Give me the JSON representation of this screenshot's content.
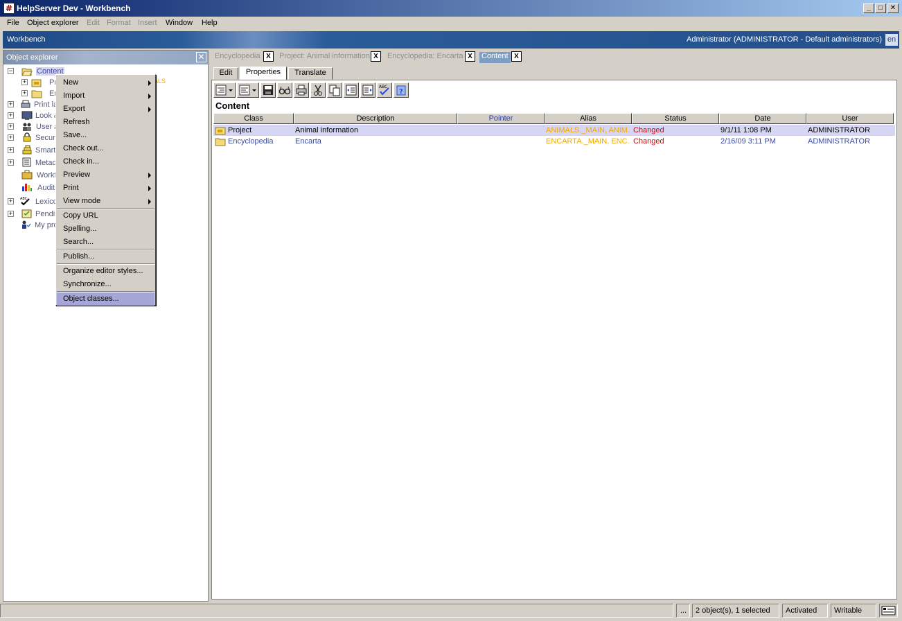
{
  "window": {
    "title": "HelpServer Dev - Workbench",
    "app_icon_glyph": "#",
    "minimize": "_",
    "maximize": "□",
    "close": "✕"
  },
  "menubar": {
    "items": [
      {
        "label": "File",
        "enabled": true
      },
      {
        "label": "Object explorer",
        "enabled": true
      },
      {
        "label": "Edit",
        "enabled": false
      },
      {
        "label": "Format",
        "enabled": false
      },
      {
        "label": "Insert",
        "enabled": false
      },
      {
        "label": "Window",
        "enabled": true
      },
      {
        "label": "Help",
        "enabled": true
      }
    ]
  },
  "workbench": {
    "title": "Workbench",
    "user": "Administrator (ADMINISTRATOR - Default administrators)",
    "language": "en"
  },
  "object_explorer": {
    "title": "Object explorer",
    "close_glyph": "✕",
    "tree": [
      {
        "label": "Content",
        "selected": true
      },
      {
        "label": "Pr"
      },
      {
        "label": "Er"
      },
      {
        "label": "Print la"
      },
      {
        "label": "Look &"
      },
      {
        "label": "User a"
      },
      {
        "label": "Secur"
      },
      {
        "label": "Smart"
      },
      {
        "label": "Metad"
      },
      {
        "label": "Workf"
      },
      {
        "label": "Auditi"
      },
      {
        "label": "Lexico"
      },
      {
        "label": "Pendir"
      },
      {
        "label": "My pro"
      }
    ],
    "tree_suffix": "ALS"
  },
  "context_menu": {
    "items": [
      {
        "label": "New",
        "submenu": true
      },
      {
        "label": "Import",
        "submenu": true
      },
      {
        "label": "Export",
        "submenu": true
      },
      {
        "label": "Refresh"
      },
      {
        "label": "Save..."
      },
      {
        "label": "Check out..."
      },
      {
        "label": "Check in..."
      },
      {
        "label": "Preview",
        "submenu": true
      },
      {
        "label": "Print",
        "submenu": true
      },
      {
        "label": "View mode",
        "submenu": true
      },
      {
        "label": "Copy URL"
      },
      {
        "label": "Spelling..."
      },
      {
        "label": "Search..."
      },
      {
        "label": "Publish..."
      },
      {
        "label": "Organize editor styles..."
      },
      {
        "label": "Synchronize..."
      },
      {
        "label": "Object classes...",
        "selected": true
      }
    ]
  },
  "document_tabs": [
    {
      "label": "Encyclopedia",
      "active": false
    },
    {
      "label": "Project: Animal information",
      "active": false
    },
    {
      "label": "Encyclopedia: Encarta",
      "active": false
    },
    {
      "label": "Content",
      "active": true
    }
  ],
  "tab_close_glyph": "X",
  "subtabs": [
    {
      "label": "Edit",
      "active": false
    },
    {
      "label": "Properties",
      "active": true
    },
    {
      "label": "Translate",
      "active": false
    }
  ],
  "content": {
    "title": "Content",
    "columns": [
      "Class",
      "Description",
      "Pointer",
      "Alias",
      "Status",
      "Date",
      "User"
    ],
    "rows": [
      {
        "class": "Project",
        "description": "Animal information",
        "pointer": "",
        "alias": "ANIMALS._MAIN, ANIM...",
        "status": "Changed",
        "date": "9/1/11 1:08 PM",
        "user": "ADMINISTRATOR",
        "selected": true
      },
      {
        "class": "Encyclopedia",
        "description": "Encarta",
        "pointer": "",
        "alias": "ENCARTA._MAIN, ENC...",
        "status": "Changed",
        "date": "2/16/09 3:11 PM",
        "user": "ADMINISTRATOR",
        "selected": false
      }
    ]
  },
  "toolbar_icons": [
    "indent-menu-icon",
    "outdent-menu-icon",
    "save-icon",
    "preview-glasses-icon",
    "print-icon",
    "cut-icon",
    "copy-icon",
    "move-up-icon",
    "move-down-icon",
    "spelling-icon",
    "help-icon"
  ],
  "statusbar": {
    "ellipsis": "...",
    "selection": "2 object(s), 1 selected",
    "state": "Activated",
    "mode": "Writable"
  },
  "colors": {
    "alias": "#f0a800",
    "status_changed": "#e00000",
    "link_text": "#3a4aa0",
    "selected_row": "#d6d6f4",
    "menu_selected": "#a6a6d6"
  }
}
